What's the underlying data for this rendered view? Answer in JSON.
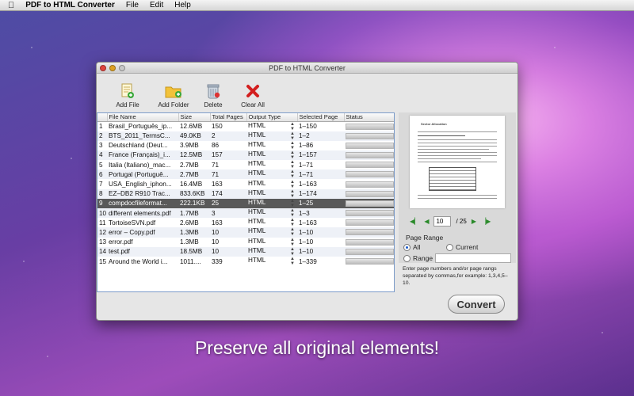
{
  "menubar": {
    "app_name": "PDF to HTML Converter",
    "items": [
      "File",
      "Edit",
      "Help"
    ]
  },
  "window": {
    "title": "PDF to HTML Converter"
  },
  "toolbar": {
    "add_file": "Add File",
    "add_folder": "Add Folder",
    "delete": "Delete",
    "clear_all": "Clear All"
  },
  "table": {
    "columns": [
      "File Name",
      "Size",
      "Total Pages",
      "Output Type",
      "Selected Page",
      "Status"
    ],
    "rows": [
      {
        "n": "1",
        "name": "Brasil_Português_ip...",
        "size": "12.6MB",
        "pages": "150",
        "type": "HTML",
        "sel": "1–150"
      },
      {
        "n": "2",
        "name": "BTS_2011_TermsC...",
        "size": "49.0KB",
        "pages": "2",
        "type": "HTML",
        "sel": "1–2"
      },
      {
        "n": "3",
        "name": "Deutschland (Deut...",
        "size": "3.9MB",
        "pages": "86",
        "type": "HTML",
        "sel": "1–86"
      },
      {
        "n": "4",
        "name": "France (Français)_i...",
        "size": "12.5MB",
        "pages": "157",
        "type": "HTML",
        "sel": "1–157"
      },
      {
        "n": "5",
        "name": "Italia (Italiano)_mac...",
        "size": "2.7MB",
        "pages": "71",
        "type": "HTML",
        "sel": "1–71"
      },
      {
        "n": "6",
        "name": "Portugal (Portuguê...",
        "size": "2.7MB",
        "pages": "71",
        "type": "HTML",
        "sel": "1–71"
      },
      {
        "n": "7",
        "name": "USA_English_iphon...",
        "size": "16.4MB",
        "pages": "163",
        "type": "HTML",
        "sel": "1–163"
      },
      {
        "n": "8",
        "name": "EZ–DB2 R910 Trac...",
        "size": "833.6KB",
        "pages": "174",
        "type": "HTML",
        "sel": "1–174"
      },
      {
        "n": "9",
        "name": "compdocfileformat...",
        "size": "222.1KB",
        "pages": "25",
        "type": "HTML",
        "sel": "1–25",
        "selected": true
      },
      {
        "n": "10",
        "name": "different elements.pdf",
        "size": "1.7MB",
        "pages": "3",
        "type": "HTML",
        "sel": "1–3"
      },
      {
        "n": "11",
        "name": "TortoiseSVN.pdf",
        "size": "2.6MB",
        "pages": "163",
        "type": "HTML",
        "sel": "1–163"
      },
      {
        "n": "12",
        "name": "error – Copy.pdf",
        "size": "1.3MB",
        "pages": "10",
        "type": "HTML",
        "sel": "1–10"
      },
      {
        "n": "13",
        "name": "error.pdf",
        "size": "1.3MB",
        "pages": "10",
        "type": "HTML",
        "sel": "1–10"
      },
      {
        "n": "14",
        "name": "test.pdf",
        "size": "18.5MB",
        "pages": "10",
        "type": "HTML",
        "sel": "1–10"
      },
      {
        "n": "15",
        "name": "Around the World i...",
        "size": "1011....",
        "pages": "339",
        "type": "HTML",
        "sel": "1–339"
      }
    ]
  },
  "preview": {
    "heading": "Sector Allocation",
    "current_page": "10",
    "total_pages": "/ 25"
  },
  "page_range": {
    "title": "Page Range",
    "all": "All",
    "current": "Current",
    "range": "Range",
    "hint": "Enter page numbers and/or page rangs separated by commas,for example: 1,3,4,5–10."
  },
  "convert_label": "Convert",
  "caption": "Preserve all original elements!"
}
